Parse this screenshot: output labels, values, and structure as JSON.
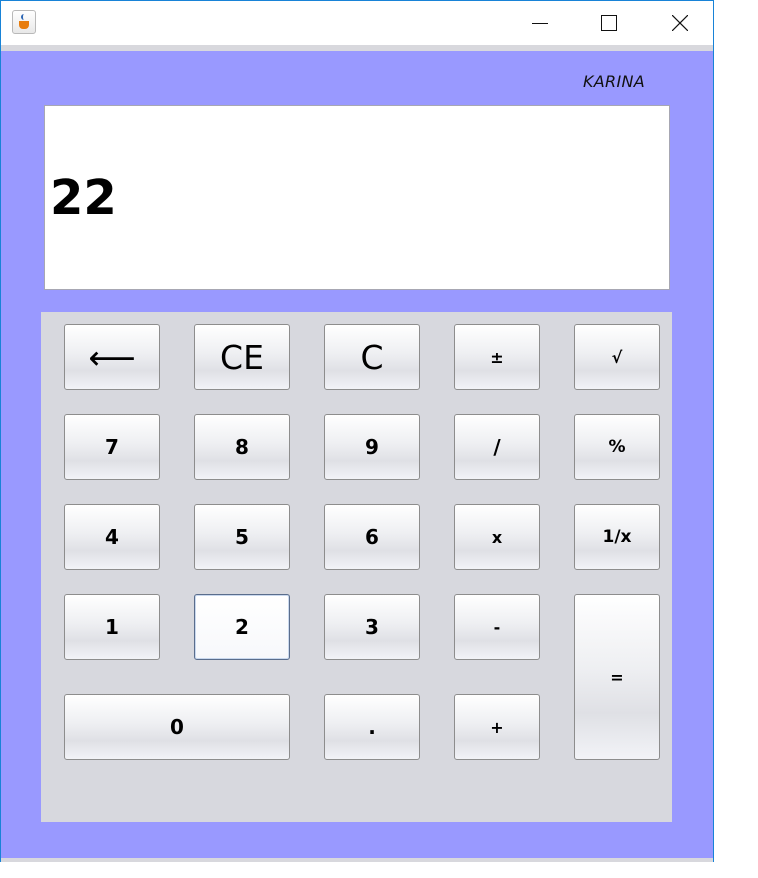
{
  "window": {
    "app_icon": "java-coffee-icon",
    "controls": {
      "minimize_icon": "minimize-icon",
      "maximize_icon": "maximize-icon",
      "close_icon": "close-icon"
    }
  },
  "author_label": "KARINA",
  "display": {
    "value": "22"
  },
  "colors": {
    "client_background": "#9999ff",
    "keypad_background": "#d7d8de",
    "display_background": "#ffffff"
  },
  "keys": {
    "backspace": "⟵",
    "clear_entry": "CE",
    "clear": "C",
    "plus_minus": "±",
    "sqrt": "√",
    "seven": "7",
    "eight": "8",
    "nine": "9",
    "divide": "/",
    "percent": "%",
    "four": "4",
    "five": "5",
    "six": "6",
    "multiply": "x",
    "reciprocal": "1/x",
    "one": "1",
    "two": "2",
    "three": "3",
    "minus": "-",
    "equals": "=",
    "zero": "0",
    "decimal": ".",
    "plus": "+"
  }
}
